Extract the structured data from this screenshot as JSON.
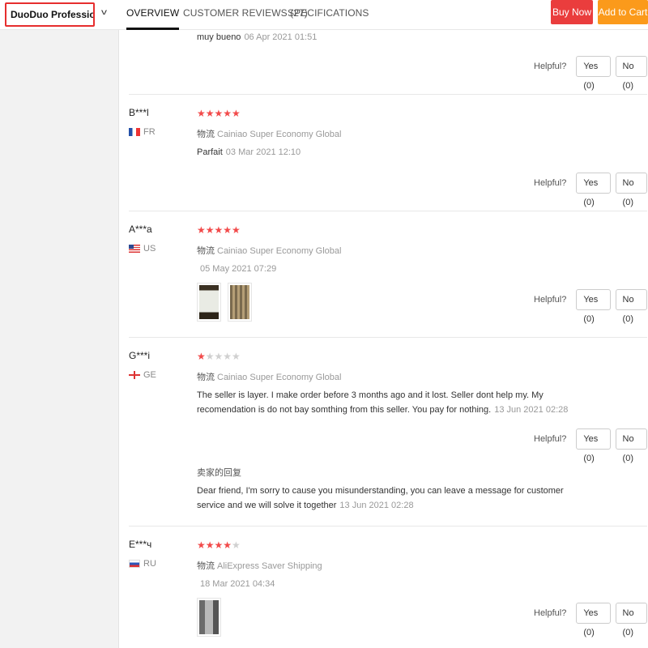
{
  "header": {
    "store_name": "DuoDuo Profession...",
    "tabs": [
      "OVERVIEW",
      "CUSTOMER REVIEWS (27)",
      "SPECIFICATIONS"
    ],
    "buy_now": "Buy Now",
    "add_to_cart": "Add to Cart"
  },
  "helpful": {
    "label": "Helpful?",
    "yes": "Yes (0)",
    "no": "No (0)"
  },
  "ship_label": "物流",
  "reviews": [
    {
      "text": "muy bueno",
      "date": "06 Apr 2021 01:51"
    },
    {
      "name": "B***l",
      "country": "FR",
      "rating": 5,
      "shipping": "Cainiao Super Economy Global",
      "text": "Parfait",
      "date": "03 Mar 2021 12:10"
    },
    {
      "name": "A***a",
      "country": "US",
      "rating": 5,
      "shipping": "Cainiao Super Economy Global",
      "text": "",
      "date": "05 May 2021 07:29"
    },
    {
      "name": "G***i",
      "country": "GE",
      "rating": 1,
      "shipping": "Cainiao Super Economy Global",
      "text": "The seller is layer. I make order before 3 months ago and it lost. Seller dont help my. My recomendation is do not bay somthing from this seller. You pay for nothing.",
      "date": "13 Jun 2021 02:28",
      "reply": {
        "title": "卖家的回复",
        "text": "Dear friend, I'm sorry to cause you misunderstanding, you can leave a message for customer service and we will solve it together",
        "date": "13 Jun 2021 02:28"
      }
    },
    {
      "name": "E***ч",
      "country": "RU",
      "rating": 4,
      "shipping": "AliExpress Saver Shipping",
      "text": "",
      "date": "18 Mar 2021 04:34"
    }
  ],
  "colors": {
    "buy_now": "#ea3d3d",
    "add_to_cart": "#fb9a1b",
    "star": "#f24a4a",
    "store_border": "#e62e2e"
  }
}
